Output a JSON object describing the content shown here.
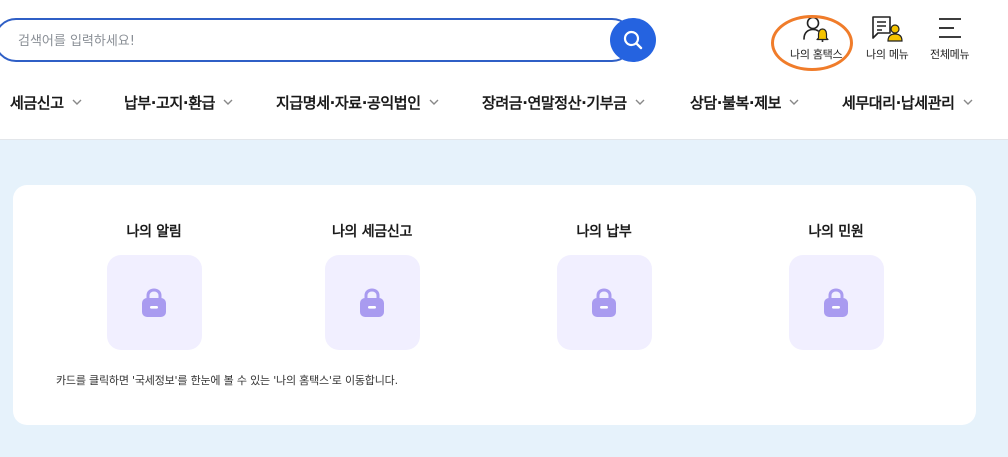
{
  "search": {
    "placeholder": "검색어를 입력하세요!",
    "value": ""
  },
  "utility_menu": {
    "my_hometax": "나의 홈택스",
    "my_menu": "나의 메뉴",
    "all_menu": "전체메뉴"
  },
  "gnb": {
    "items": [
      "세금신고",
      "납부·고지·환급",
      "지급명세·자료·공익법인",
      "장려금·연말정산·기부금",
      "상담·불복·제보",
      "세무대리·납세관리"
    ]
  },
  "cards": [
    {
      "title": "나의 알림",
      "icon": "lock-icon"
    },
    {
      "title": "나의 세금신고",
      "icon": "lock-icon"
    },
    {
      "title": "나의 납부",
      "icon": "lock-icon"
    },
    {
      "title": "나의 민원",
      "icon": "lock-icon"
    }
  ],
  "notice": "카드를 클릭하면 '국세정보'를 한눈에 볼 수 있는 '나의 홈택스'로 이동합니다.",
  "colors": {
    "accent": "#2563e0",
    "search_border": "#2f5fc6",
    "highlight": "#f07c2a",
    "background": "#e6f2fb",
    "lock": "#a99bf0",
    "tile": "#f1efff"
  }
}
